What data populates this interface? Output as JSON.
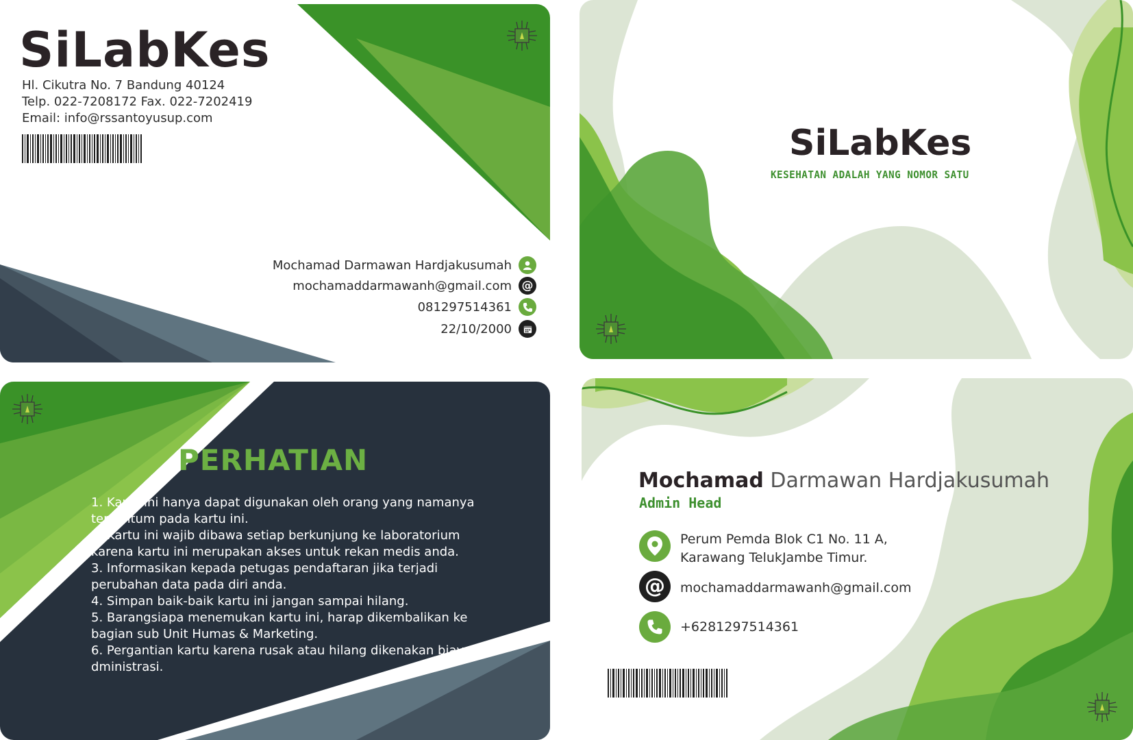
{
  "card_front_left": {
    "brand": "SiLabKes",
    "address_line": "Hl. Cikutra No. 7 Bandung 40124",
    "phone_fax_line": "Telp. 022-7208172 Fax. 022-7202419",
    "email_line": "Email: info@rssantoyusup.com",
    "contact": {
      "name": "Mochamad Darmawan Hardjakusumah",
      "email": "mochamaddarmawanh@gmail.com",
      "phone": "081297514361",
      "date": "22/10/2000"
    },
    "icons": [
      "chip-logo-icon",
      "barcode-icon",
      "user-icon",
      "at-icon",
      "phone-icon",
      "calendar-icon"
    ]
  },
  "card_front_right": {
    "brand": "SiLabKes",
    "tagline": "KESEHATAN ADALAH YANG NOMOR SATU"
  },
  "card_back_left": {
    "heading": "PERHATIAN",
    "rules": [
      "1. Kartu ini hanya dapat digunakan oleh orang yang namanya",
      "tercantum pada kartu ini.",
      "2. Kartu ini wajib dibawa setiap berkunjung ke laboratorium",
      "karena kartu ini merupakan akses untuk rekan medis anda.",
      "3. Informasikan kepada petugas pendaftaran jika terjadi",
      "perubahan data pada diri anda.",
      "4. Simpan baik-baik kartu ini jangan sampai hilang.",
      "5. Barangsiapa menemukan kartu ini, harap dikembalikan ke",
      "bagian sub Unit Humas & Marketing.",
      "6. Pergantian kartu karena rusak atau hilang dikenakan biaya",
      "dministrasi."
    ]
  },
  "card_back_right": {
    "name_first": "Mochamad",
    "name_rest": " Darmawan Hardjakusumah",
    "role": "Admin Head",
    "address_line1": "Perum Pemda Blok C1 No. 11 A,",
    "address_line2": "Karawang TelukJambe Timur.",
    "email": "mochamaddarmawanh@gmail.com",
    "phone": "+6281297514361"
  },
  "colors": {
    "green_dark": "#3a9228",
    "green_mid": "#6aab3e",
    "green_light": "#8bc34a",
    "green_pale": "#dce5d4",
    "navy": "#27313d",
    "slate": "#5f7480",
    "ink": "#2a2326"
  }
}
